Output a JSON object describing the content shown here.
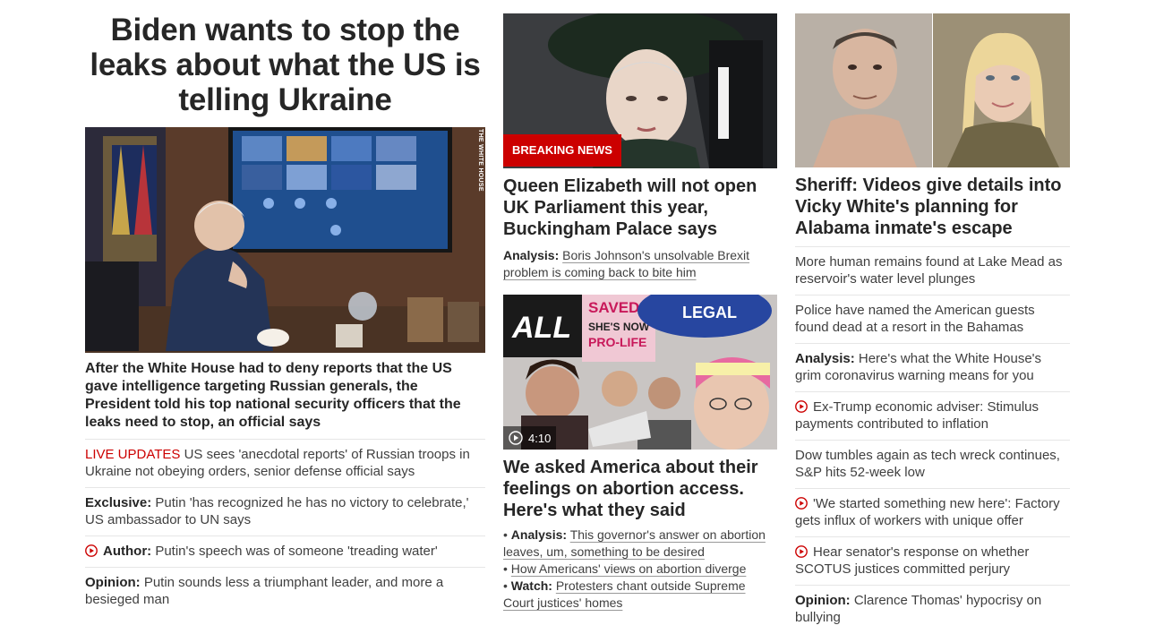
{
  "col1": {
    "headline": "Biden wants to stop the leaks about what the US is telling Ukraine",
    "photo_credit": "THE WHITE HOUSE",
    "lede": "After the White House had to deny reports that the US gave intelligence targeting Russian generals, the President told his top national security officers that the leaks need to stop, an official says",
    "items": [
      {
        "prefix": "LIVE UPDATES",
        "text": " US sees 'anecdotal reports' of Russian troops in Ukraine not obeying orders, senior defense official says"
      },
      {
        "prefix": "Exclusive:",
        "text": " Putin 'has recognized he has no victory to celebrate,' US ambassador to UN says"
      },
      {
        "prefix": "Author:",
        "text": " Putin's speech was of someone 'treading water'"
      },
      {
        "prefix": "Opinion:",
        "text": " Putin sounds less a triumphant leader, and more a besieged man"
      }
    ]
  },
  "col2": {
    "card1": {
      "badge": "BREAKING NEWS",
      "title": "Queen Elizabeth will not open UK Parliament this year, Buckingham Palace says",
      "sub_prefix": "Analysis:",
      "sub_text": "Boris Johnson's unsolvable Brexit problem is coming back to bite him"
    },
    "card2": {
      "video_duration": "4:10",
      "sign_text_1": "SAVED",
      "sign_text_2": "SHE'S NOW PRO-LIFE",
      "sign_text_3": "LEGAL",
      "title": "We asked America about their feelings on abortion access. Here's what they said",
      "bullets": [
        {
          "prefix": "Analysis:",
          "text": "This governor's answer on abortion leaves, um, something to be desired"
        },
        {
          "prefix": "",
          "text": "How Americans' views on abortion diverge"
        },
        {
          "prefix": "Watch:",
          "text": "Protesters chant outside Supreme Court justices' homes"
        }
      ]
    }
  },
  "col3": {
    "title": "Sheriff: Videos give details into Vicky White's planning for Alabama inmate's escape",
    "items": [
      {
        "prefix": "",
        "text": "More human remains found at Lake Mead as reservoir's water level plunges"
      },
      {
        "prefix": "",
        "text": "Police have named the American guests found dead at a resort in the Bahamas"
      },
      {
        "prefix": "Analysis:",
        "text": " Here's what the White House's grim coronavirus warning means for you"
      },
      {
        "prefix": "",
        "text": "Ex-Trump economic adviser: Stimulus payments contributed to inflation"
      },
      {
        "prefix": "",
        "text": "Dow tumbles again as tech wreck continues, S&P hits 52-week low"
      },
      {
        "prefix": "",
        "text": "'We started something new here': Factory gets influx of workers with unique offer"
      },
      {
        "prefix": "",
        "text": "Hear senator's response on whether SCOTUS justices committed perjury"
      },
      {
        "prefix": "Opinion:",
        "text": " Clarence Thomas' hypocrisy on bullying"
      }
    ]
  },
  "colors": {
    "accent_red": "#cc0000",
    "text": "#262626",
    "divider": "#e6e6e6"
  }
}
